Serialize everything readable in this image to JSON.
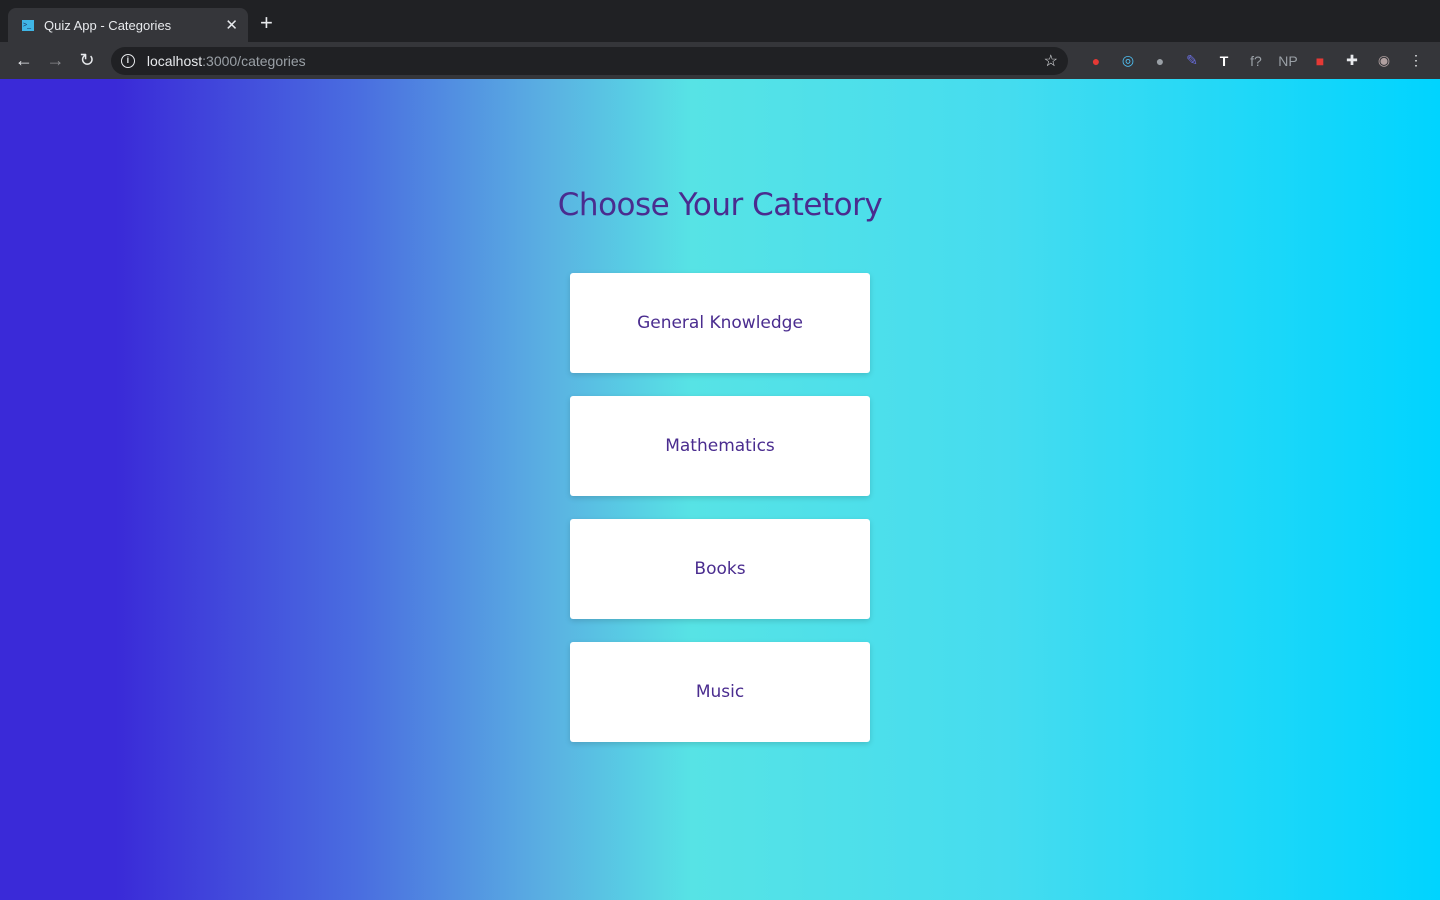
{
  "browser": {
    "tab_title": "Quiz App - Categories",
    "url_host": "localhost",
    "url_rest": ":3000/categories",
    "extensions": [
      "stop-hand-icon",
      "circle-ring-icon",
      "mic-icon",
      "pen-icon",
      "text-t-icon",
      "f?",
      "NP",
      "gear-red-icon",
      "puzzle-icon",
      "avatar"
    ]
  },
  "page": {
    "heading": "Choose Your Catetory",
    "categories": [
      "General Knowledge",
      "Mathematics",
      "Books",
      "Music"
    ]
  }
}
